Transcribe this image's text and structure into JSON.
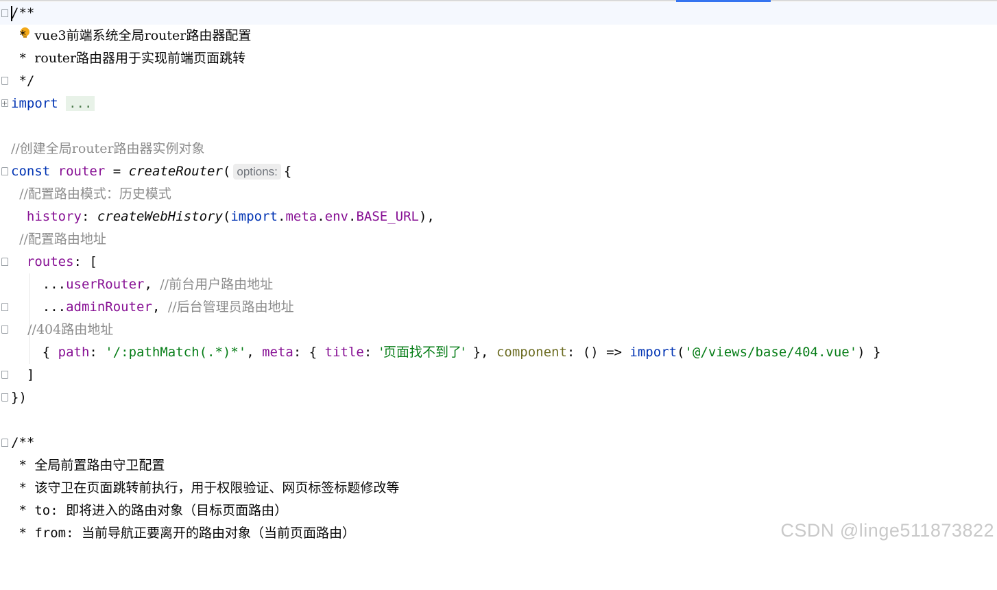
{
  "lines": [
    {
      "text": "/**"
    },
    {
      "star": " * ",
      "text": "vue3前端系统全局router路由器配置"
    },
    {
      "star": " * ",
      "text": "router路由器用于实现前端页面跳转"
    },
    {
      "text": " */"
    },
    {
      "kw": "import",
      "dots": "..."
    },
    {
      "text": ""
    },
    {
      "text": "//创建全局router路由器实例对象"
    },
    {
      "kw": "const",
      "var": "router",
      "op": " = ",
      "fn": "createRouter",
      "paren": "(",
      "hint": "options:",
      "brace": "{"
    },
    {
      "text": "  //配置路由模式：历史模式"
    },
    {
      "key": "history",
      "fn": "createWebHistory",
      "a": "import",
      "b": "meta",
      "c": "env",
      "d": "BASE_URL"
    },
    {
      "text": "  //配置路由地址"
    },
    {
      "key": "routes",
      "rest": ": ["
    },
    {
      "dots": "...",
      "var": "userRouter",
      "comment": "//前台用户路由地址"
    },
    {
      "dots": "...",
      "var": "adminRouter",
      "comment": "//后台管理员路由地址"
    },
    {
      "text": "    //404路由地址"
    },
    {
      "path_key": "path",
      "path_val": "'/:pathMatch(.*)*'",
      "meta_key": "meta",
      "title_key": "title",
      "title_val": "'页面找不到了'",
      "comp_key": "component",
      "imp": "import",
      "imp_val": "'@/views/base/404.vue'"
    },
    {
      "text": "  ]"
    },
    {
      "text": "})"
    },
    {
      "text": ""
    },
    {
      "text": "/**"
    },
    {
      "star": " * ",
      "text": "全局前置路由守卫配置"
    },
    {
      "star": " * ",
      "text": "该守卫在页面跳转前执行，用于权限验证、网页标签标题修改等"
    },
    {
      "star": " * ",
      "label": "to:",
      "text": "即将进入的路由对象（目标页面路由）"
    },
    {
      "star": " * ",
      "label": "from:",
      "text": "当前导航正要离开的路由对象（当前页面路由）"
    }
  ],
  "watermark": "CSDN @linge511873822",
  "colors": {
    "keyword": "#0033b3",
    "property": "#871094",
    "string": "#067d17",
    "comment": "#8c8c8c",
    "accent": "#3574f0"
  }
}
